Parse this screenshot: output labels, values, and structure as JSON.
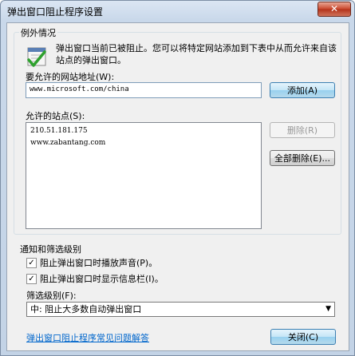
{
  "window": {
    "title": "弹出窗口阻止程序设置",
    "close_glyph": "✕"
  },
  "exceptions": {
    "group_label": "例外情况",
    "description": "弹出窗口当前已被阻止。您可以将特定网站添加到下表中从而允许来自该站点的弹出窗口。",
    "address_label": "要允许的网站地址(W):",
    "address_value": "www.microsoft.com/china",
    "add_button": "添加(A)",
    "allowed_label": "允许的站点(S):",
    "allowed_sites": [
      "210.51.181.175",
      "www.zabantang.com"
    ],
    "remove_button": "删除(R)",
    "remove_all_button": "全部删除(E)..."
  },
  "notify": {
    "group_label": "通知和筛选级别",
    "play_sound": "阻止弹出窗口时播放声音(P)。",
    "show_infobar": "阻止弹出窗口时显示信息栏(I)。",
    "filter_label": "筛选级别(F):",
    "filter_value": "中: 阻止大多数自动弹出窗口"
  },
  "footer": {
    "faq_link": "弹出窗口阻止程序常见问题解答",
    "close_button": "关闭(C)"
  },
  "icons": {
    "shield": "shield-check-icon"
  }
}
